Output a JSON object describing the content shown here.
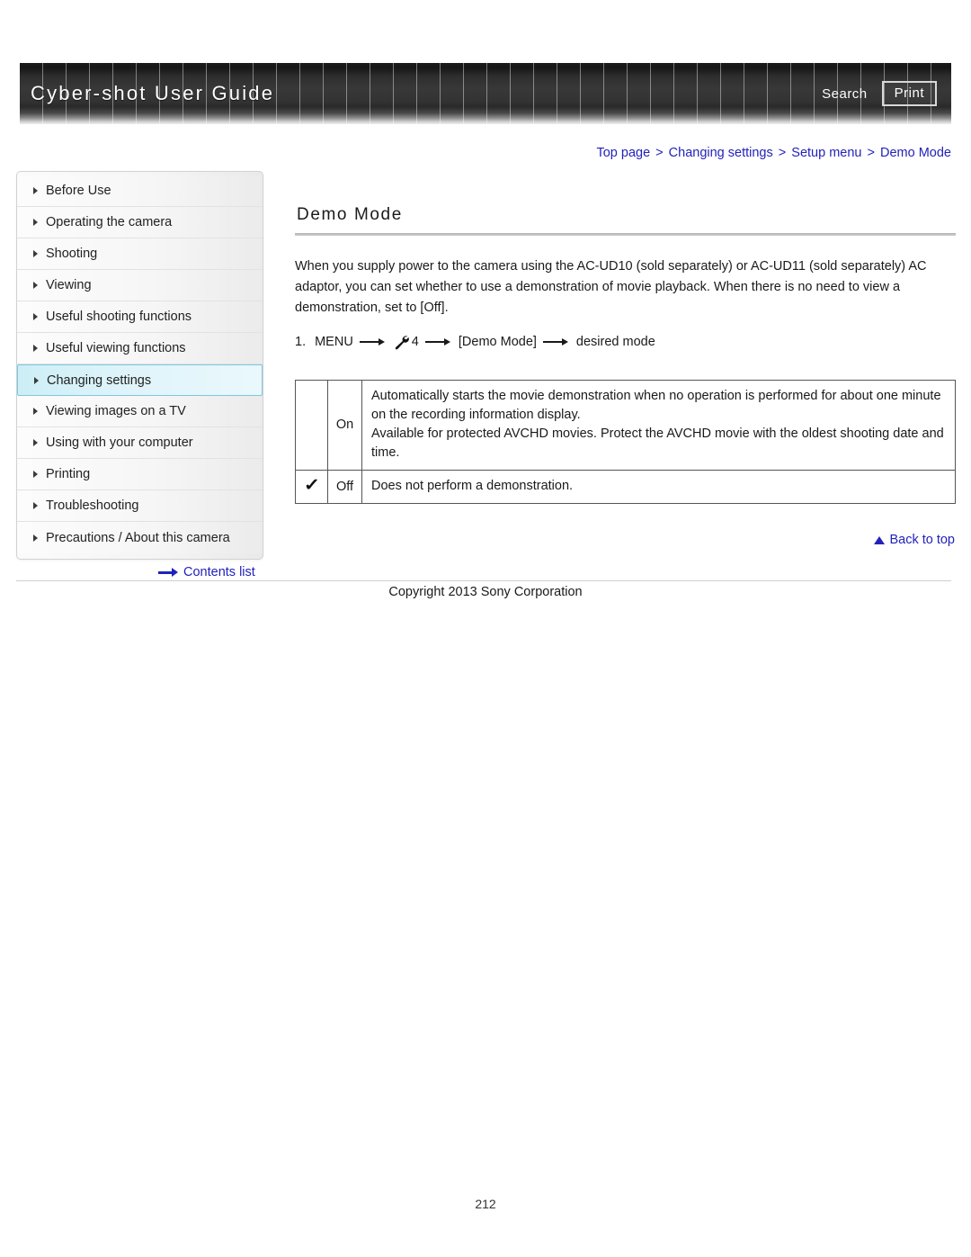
{
  "header": {
    "title": "Cyber-shot User Guide",
    "search_label": "Search",
    "print_label": "Print"
  },
  "breadcrumb": {
    "items": [
      {
        "label": "Top page"
      },
      {
        "label": "Changing settings"
      },
      {
        "label": "Setup menu"
      },
      {
        "label": "Demo Mode"
      }
    ],
    "separator": ">",
    "link_color": "#2222bb"
  },
  "sidebar": {
    "items": [
      {
        "label": "Before Use",
        "active": false
      },
      {
        "label": "Operating the camera",
        "active": false
      },
      {
        "label": "Shooting",
        "active": false
      },
      {
        "label": "Viewing",
        "active": false
      },
      {
        "label": "Useful shooting functions",
        "active": false
      },
      {
        "label": "Useful viewing functions",
        "active": false
      },
      {
        "label": "Changing settings",
        "active": true
      },
      {
        "label": "Viewing images on a TV",
        "active": false
      },
      {
        "label": "Using with your computer",
        "active": false
      },
      {
        "label": "Printing",
        "active": false
      },
      {
        "label": "Troubleshooting",
        "active": false
      },
      {
        "label": "Precautions / About this camera",
        "active": false
      }
    ],
    "active_highlight_color": "#cdeef6",
    "contents_list_label": "Contents list"
  },
  "main": {
    "title": "Demo Mode",
    "intro": "When you supply power to the camera using the AC-UD10 (sold separately) or AC-UD11 (sold separately) AC adaptor, you can set whether to use a demonstration of movie playback. When there is no need to view a demonstration, set to [Off].",
    "step": {
      "number": "1.",
      "part1": "MENU",
      "icon": "wrench-icon",
      "part2": "4",
      "part3": "[Demo Mode]",
      "part4": "desired mode"
    },
    "table": {
      "rows": [
        {
          "checked": "",
          "option": "On",
          "description": "Automatically starts the movie demonstration when no operation is performed for about one minute on the recording information display.\nAvailable for protected AVCHD movies. Protect the AVCHD movie with the oldest shooting date and time."
        },
        {
          "checked": "✓",
          "option": "Off",
          "description": "Does not perform a demonstration."
        }
      ]
    },
    "back_to_top_label": "Back to top"
  },
  "footer": {
    "copyright": "Copyright 2013 Sony Corporation",
    "page_number": "212"
  }
}
